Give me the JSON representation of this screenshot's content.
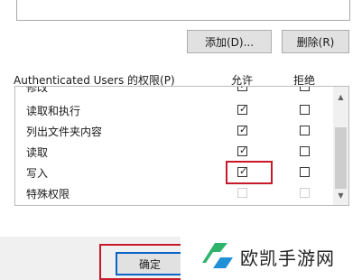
{
  "buttons": {
    "add": "添加(D)...",
    "remove": "删除(R)",
    "ok": "确定"
  },
  "permissions": {
    "header_label": "Authenticated Users 的权限(P)",
    "allow_header": "允许",
    "deny_header": "拒绝",
    "rows": [
      {
        "label": "修改",
        "allow": true,
        "deny": false,
        "disabled": false,
        "partial": true
      },
      {
        "label": "读取和执行",
        "allow": true,
        "deny": false,
        "disabled": false
      },
      {
        "label": "列出文件夹内容",
        "allow": true,
        "deny": false,
        "disabled": false
      },
      {
        "label": "读取",
        "allow": true,
        "deny": false,
        "disabled": false
      },
      {
        "label": "写入",
        "allow": true,
        "deny": false,
        "disabled": false
      },
      {
        "label": "特殊权限",
        "allow": false,
        "deny": false,
        "disabled": true
      }
    ]
  },
  "watermark": {
    "text": "欧凯手游网"
  },
  "colors": {
    "highlight": "#c8192a",
    "accent": "#0a64c8",
    "watermark_green": "#2fb36a"
  }
}
